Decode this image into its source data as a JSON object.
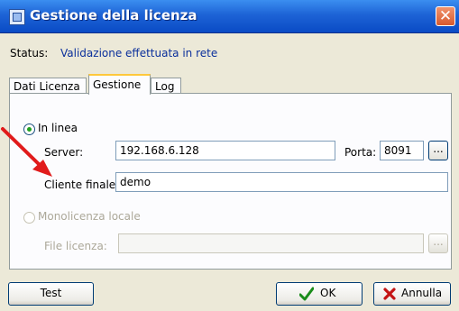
{
  "window": {
    "title": "Gestione della licenza",
    "close_glyph": "✕"
  },
  "status": {
    "label": "Status:",
    "value": "Validazione effettuata in rete"
  },
  "tabs": [
    {
      "label": "Dati Licenza",
      "active": false
    },
    {
      "label": "Gestione",
      "active": true
    },
    {
      "label": "Log",
      "active": false
    }
  ],
  "online": {
    "radio_label": "In linea",
    "selected": true,
    "server_label": "Server:",
    "server_value": "192.168.6.128",
    "porta_label": "Porta:",
    "porta_value": "8091",
    "browse_label": "...",
    "cliente_label": "Cliente finale:",
    "cliente_value": "demo"
  },
  "local": {
    "radio_label": "Monolicenza locale",
    "selected": false,
    "file_label": "File licenza:",
    "file_value": "",
    "browse_label": "..."
  },
  "buttons": {
    "test": "Test",
    "ok": "OK",
    "annulla": "Annulla"
  },
  "colors": {
    "status_value": "#0a2f9b",
    "radio_dot": "#21a121",
    "annotation_arrow": "#e11b1b"
  },
  "icons": {
    "ok": "green-check-icon",
    "annulla": "red-x-icon",
    "window": "app-window-icon"
  }
}
